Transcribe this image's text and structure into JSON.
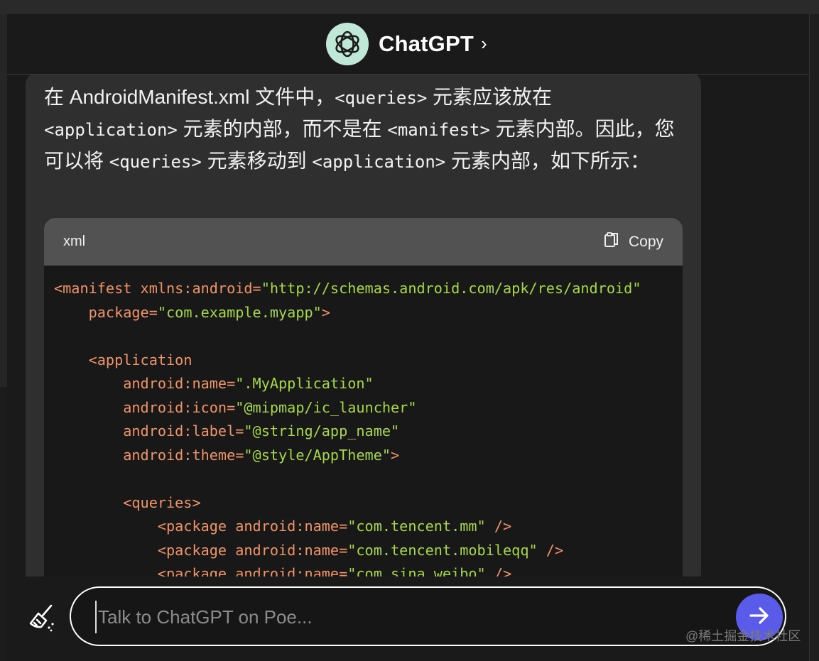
{
  "app": {
    "title": "ChatGPT",
    "title_chevron": "›"
  },
  "message": {
    "parts": [
      {
        "text": "在 AndroidManifest.xml 文件中，",
        "mono": false
      },
      {
        "text": "<queries>",
        "mono": true
      },
      {
        "text": " 元素应该放在 ",
        "mono": false
      },
      {
        "text": "<application>",
        "mono": true
      },
      {
        "text": " 元素的内部，而不是在 ",
        "mono": false
      },
      {
        "text": "<manifest>",
        "mono": true
      },
      {
        "text": " 元素内部。因此，您可以将 ",
        "mono": false
      },
      {
        "text": "<queries>",
        "mono": true
      },
      {
        "text": " 元素移动到 ",
        "mono": false
      },
      {
        "text": "<application>",
        "mono": true
      },
      {
        "text": " 元素内部，如下所示：",
        "mono": false
      }
    ]
  },
  "code_block": {
    "language": "xml",
    "copy_label": "Copy",
    "lines": [
      [
        {
          "c": "t",
          "v": "<manifest xmlns:android="
        },
        {
          "c": "s",
          "v": "\"http://schemas.android.com/apk/res/android\""
        }
      ],
      [
        {
          "c": "p",
          "v": "    "
        },
        {
          "c": "t",
          "v": "package="
        },
        {
          "c": "s",
          "v": "\"com.example.myapp\""
        },
        {
          "c": "t",
          "v": ">"
        }
      ],
      [],
      [
        {
          "c": "p",
          "v": "    "
        },
        {
          "c": "t",
          "v": "<application"
        }
      ],
      [
        {
          "c": "p",
          "v": "        "
        },
        {
          "c": "t",
          "v": "android:name="
        },
        {
          "c": "s",
          "v": "\".MyApplication\""
        }
      ],
      [
        {
          "c": "p",
          "v": "        "
        },
        {
          "c": "t",
          "v": "android:icon="
        },
        {
          "c": "s",
          "v": "\"@mipmap/ic_launcher\""
        }
      ],
      [
        {
          "c": "p",
          "v": "        "
        },
        {
          "c": "t",
          "v": "android:label="
        },
        {
          "c": "s",
          "v": "\"@string/app_name\""
        }
      ],
      [
        {
          "c": "p",
          "v": "        "
        },
        {
          "c": "t",
          "v": "android:theme="
        },
        {
          "c": "s",
          "v": "\"@style/AppTheme\""
        },
        {
          "c": "t",
          "v": ">"
        }
      ],
      [],
      [
        {
          "c": "p",
          "v": "        "
        },
        {
          "c": "t",
          "v": "<queries>"
        }
      ],
      [
        {
          "c": "p",
          "v": "            "
        },
        {
          "c": "t",
          "v": "<package android:name="
        },
        {
          "c": "s",
          "v": "\"com.tencent.mm\""
        },
        {
          "c": "t",
          "v": " />"
        }
      ],
      [
        {
          "c": "p",
          "v": "            "
        },
        {
          "c": "t",
          "v": "<package android:name="
        },
        {
          "c": "s",
          "v": "\"com.tencent.mobileqq\""
        },
        {
          "c": "t",
          "v": " />"
        }
      ],
      [
        {
          "c": "p",
          "v": "            "
        },
        {
          "c": "t",
          "v": "<package android:name="
        },
        {
          "c": "s",
          "v": "\"com.sina.weibo\""
        },
        {
          "c": "t",
          "v": " />"
        }
      ]
    ]
  },
  "composer": {
    "placeholder": "Talk to ChatGPT on Poe...",
    "value": "",
    "clear_icon": "broom-icon",
    "send_icon": "arrow-right-icon"
  },
  "watermark": "@稀土掘金技术社区",
  "colors": {
    "accent": "#5b5bea",
    "tag": "#f0946a",
    "string": "#a6d84a",
    "logo_bg": "#bfe8d8"
  }
}
